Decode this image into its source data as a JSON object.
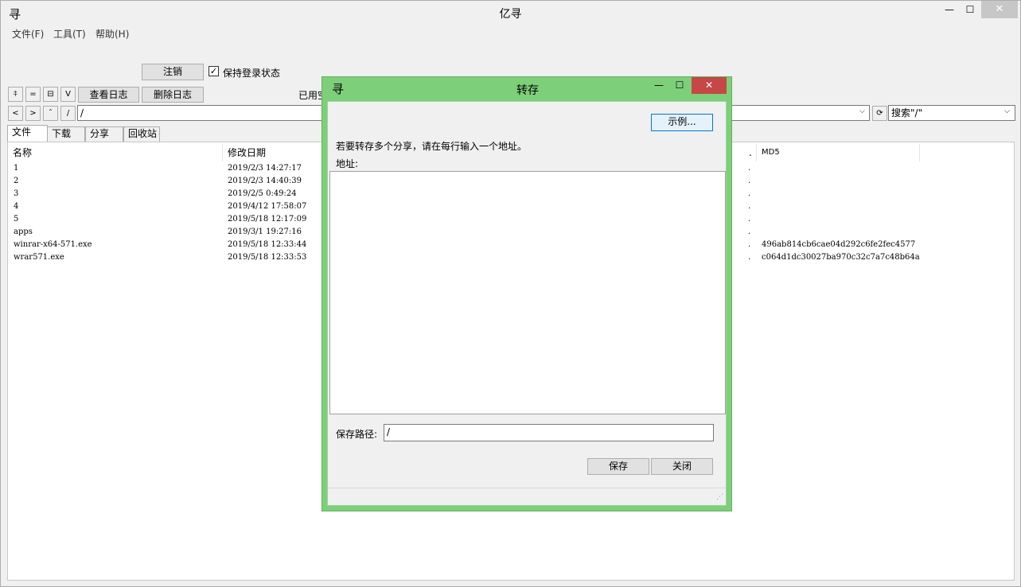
{
  "window": {
    "title": "亿寻",
    "logo": "寻",
    "controls": {
      "minimize": "—",
      "maximize": "☐",
      "close": "✕"
    }
  },
  "menu": [
    "文件(F)",
    "工具(T)",
    "帮助(H)"
  ],
  "account": {
    "logout_label": "注销",
    "keep_login_label": "保持登录状态",
    "keep_login_checked": true
  },
  "toolbar": {
    "icon_buttons": [
      "⍏",
      "=",
      "⊟",
      "V"
    ],
    "view_log_label": "查看日志",
    "delete_log_label": "删除日志",
    "used_space_label": "已用空"
  },
  "nav": {
    "back": "<",
    "forward": ">",
    "up": "ˆ",
    "root": "/",
    "path": "/",
    "search_text": "搜索\"/\""
  },
  "tabs": [
    "文件",
    "下载",
    "分享",
    "回收站"
  ],
  "files": {
    "columns": [
      "名称",
      "修改日期",
      ".",
      "MD5"
    ],
    "rows": [
      {
        "name": "1",
        "date": "2019/2/3 14:27:17",
        "dot": ".",
        "md5": ""
      },
      {
        "name": "2",
        "date": "2019/2/3 14:40:39",
        "dot": ".",
        "md5": ""
      },
      {
        "name": "3",
        "date": "2019/2/5 0:49:24",
        "dot": ".",
        "md5": ""
      },
      {
        "name": "4",
        "date": "2019/4/12 17:58:07",
        "dot": ".",
        "md5": ""
      },
      {
        "name": "5",
        "date": "2019/5/18 12:17:09",
        "dot": ".",
        "md5": ""
      },
      {
        "name": "apps",
        "date": "2019/3/1 19:27:16",
        "dot": ".",
        "md5": ""
      },
      {
        "name": "winrar-x64-571.exe",
        "date": "2019/5/18 12:33:44",
        "dot": ".",
        "md5": "496ab814cb6cae04d292c6fe2fec4577"
      },
      {
        "name": "wrar571.exe",
        "date": "2019/5/18 12:33:53",
        "dot": ".",
        "md5": "c064d1dc30027ba970c32c7a7c48b64a"
      }
    ]
  },
  "dialog": {
    "title": "转存",
    "logo": "寻",
    "controls": {
      "minimize": "—",
      "maximize": "☐",
      "close": "✕"
    },
    "example_label": "示例...",
    "instruction": "若要转存多个分享，请在每行输入一个地址。",
    "address_label": "地址:",
    "address_value": "",
    "save_path_label": "保存路径:",
    "save_path_value": "/",
    "save_label": "保存",
    "close_label": "关闭"
  },
  "colors": {
    "dialog_frame": "#7dcf7a",
    "close_button": "#c74646"
  }
}
